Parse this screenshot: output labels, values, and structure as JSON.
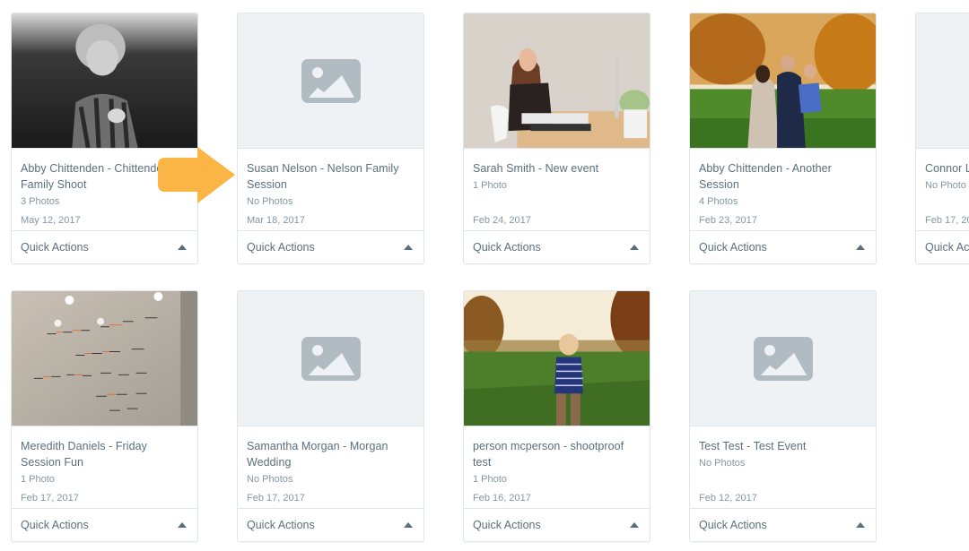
{
  "accent_color": "#fbb544",
  "quick_actions_label": "Quick Actions",
  "events": [
    {
      "title": "Abby Chittenden - Chittenden Family Shoot",
      "photos": "3 Photos",
      "date": "May 12, 2017",
      "thumbnail": "bw-child-field"
    },
    {
      "title": "Susan Nelson - Nelson Family Session",
      "photos": "No Photos",
      "date": "Mar 18, 2017",
      "thumbnail": "placeholder-image-icon"
    },
    {
      "title": "Sarah Smith - New event",
      "photos": "1 Photo",
      "date": "Feb 24, 2017",
      "thumbnail": "woman-at-desk"
    },
    {
      "title": "Abby Chittenden - Another Session",
      "photos": "4 Photos",
      "date": "Feb 23, 2017",
      "thumbnail": "family-autumn"
    },
    {
      "title": "Connor L",
      "photos": "No Photo",
      "date": "Feb 17, 20",
      "thumbnail": "placeholder-image-icon"
    },
    {
      "title": "Meredith Daniels - Friday Session Fun",
      "photos": "1 Photo",
      "date": "Feb 17, 2017",
      "thumbnail": "whiteboard-wall"
    },
    {
      "title": "Samantha Morgan - Morgan Wedding",
      "photos": "No Photos",
      "date": "Feb 17, 2017",
      "thumbnail": "placeholder-image-icon"
    },
    {
      "title": "person mcperson - shootproof test",
      "photos": "1 Photo",
      "date": "Feb 16, 2017",
      "thumbnail": "boy-in-field"
    },
    {
      "title": "Test Test - Test Event",
      "photos": "No Photos",
      "date": "Feb 12, 2017",
      "thumbnail": "placeholder-image-icon"
    }
  ]
}
